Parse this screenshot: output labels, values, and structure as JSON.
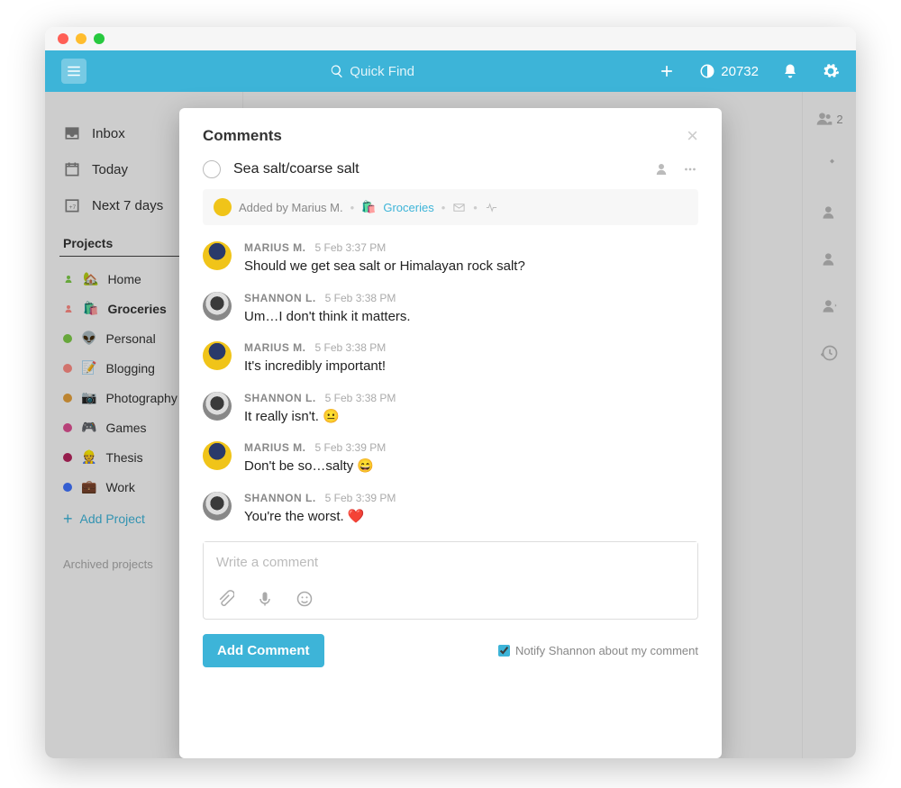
{
  "topbar": {
    "search_placeholder": "Quick Find",
    "karma": "20732"
  },
  "sidebar": {
    "nav": [
      {
        "label": "Inbox"
      },
      {
        "label": "Today"
      },
      {
        "label": "Next 7 days"
      }
    ],
    "section": "Projects",
    "projects": [
      {
        "emoji": "🏡",
        "label": "Home",
        "color": "#7ecc49",
        "user": true
      },
      {
        "emoji": "🛍️",
        "label": "Groceries",
        "color": "#ff8d85",
        "user": true,
        "active": true
      },
      {
        "emoji": "👽",
        "label": "Personal",
        "color": "#7ecc49"
      },
      {
        "emoji": "📝",
        "label": "Blogging",
        "color": "#ff8d85"
      },
      {
        "emoji": "📷",
        "label": "Photography",
        "color": "#e6a23c"
      },
      {
        "emoji": "🎮",
        "label": "Games",
        "color": "#e05194"
      },
      {
        "emoji": "👷",
        "label": "Thesis",
        "color": "#b8255f"
      },
      {
        "emoji": "💼",
        "label": "Work",
        "color": "#4073ff"
      }
    ],
    "add_project": "Add Project",
    "archived": "Archived projects"
  },
  "right_rail": {
    "share_count": "2"
  },
  "modal": {
    "title": "Comments",
    "task": "Sea salt/coarse salt",
    "meta": {
      "added_by": "Added by Marius M.",
      "project_emoji": "🛍️",
      "project": "Groceries"
    },
    "comments": [
      {
        "author": "MARIUS M.",
        "time": "5 Feb 3:37 PM",
        "text": "Should we get sea salt or Himalayan rock salt?",
        "avatar": "m"
      },
      {
        "author": "SHANNON L.",
        "time": "5 Feb 3:38 PM",
        "text": "Um…I don't think it matters.",
        "avatar": "s"
      },
      {
        "author": "MARIUS M.",
        "time": "5 Feb 3:38 PM",
        "text": "It's incredibly important!",
        "avatar": "m"
      },
      {
        "author": "SHANNON L.",
        "time": "5 Feb 3:38 PM",
        "text": "It really isn't. 😐",
        "avatar": "s"
      },
      {
        "author": "MARIUS M.",
        "time": "5 Feb 3:39 PM",
        "text": "Don't be so…salty 😄",
        "avatar": "m"
      },
      {
        "author": "SHANNON L.",
        "time": "5 Feb 3:39 PM",
        "text": "You're the worst. ❤️",
        "avatar": "s"
      }
    ],
    "input_placeholder": "Write a comment",
    "add_button": "Add Comment",
    "notify_label": "Notify Shannon about my comment",
    "notify_checked": true
  }
}
